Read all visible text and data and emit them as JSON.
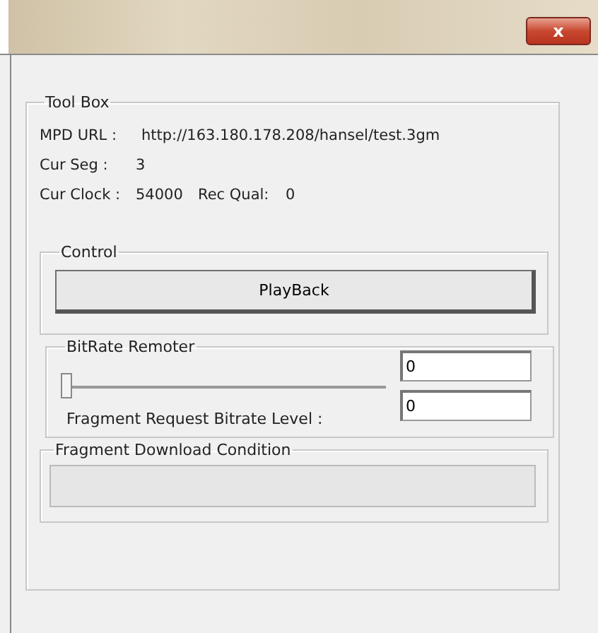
{
  "window": {
    "close_button": "x"
  },
  "tool_box": {
    "title": "Tool Box",
    "fields": [
      {
        "label": "MPD URL :",
        "value": "http://163.180.178.208/hansel/test.3gm"
      },
      {
        "label": "Cur Seg :",
        "value": "3"
      }
    ],
    "clock": {
      "label": "Cur Clock :",
      "value": "54000"
    },
    "rec_qual": {
      "label": "Rec Qual:",
      "value": "0"
    }
  },
  "control": {
    "title": "Control",
    "button": "PlayBack"
  },
  "bitrate_remoter": {
    "title": "BitRate Remoter",
    "slider": {
      "level": 0
    },
    "inputs": [
      "0",
      "0"
    ],
    "label": "Fragment Request Bitrate Level :"
  },
  "download_condition": {
    "title": "Fragment Download Condition",
    "progress": {
      "level": 0
    }
  }
}
